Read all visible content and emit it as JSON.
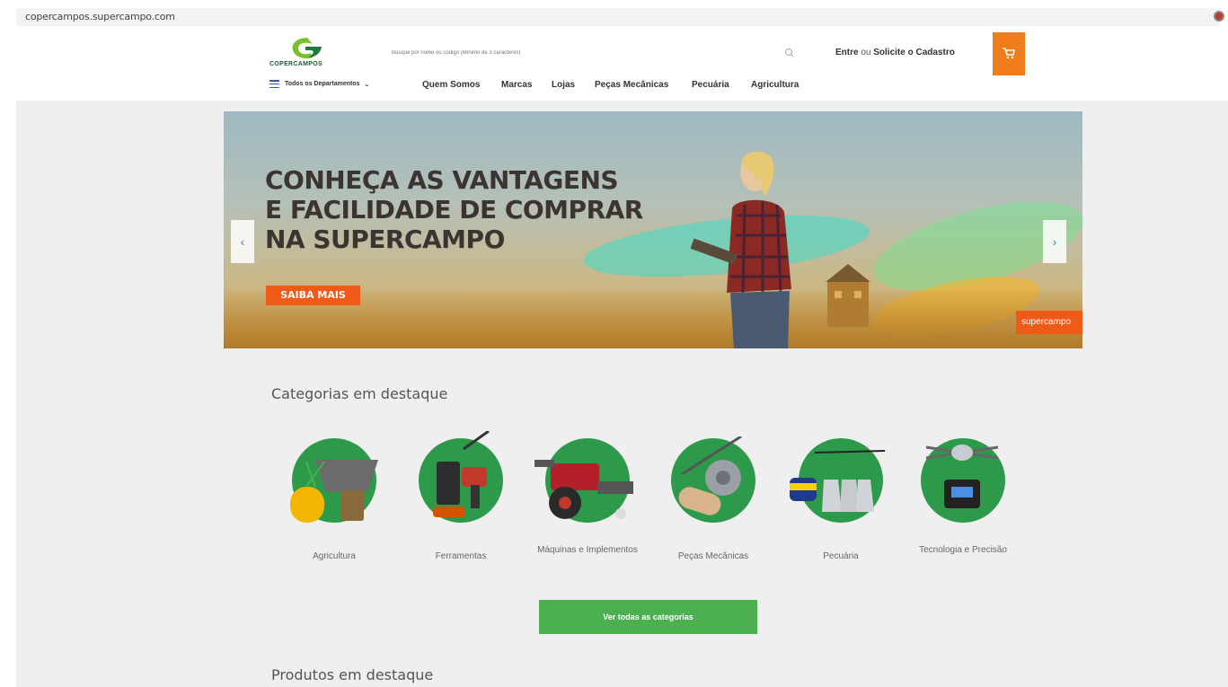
{
  "browser": {
    "url": "copercampos.supercampo.com"
  },
  "header": {
    "logo_text": "COPERCAMPOS",
    "search_placeholder": "Busque por nome ou código (Mínimo de 3 caracteres)",
    "account_enter": "Entre",
    "account_or": "ou",
    "account_register": "Solicite o Cadastro",
    "colors": {
      "accent": "#f07c1b",
      "brand_green": "#2d9a4b"
    }
  },
  "nav": {
    "all_departments": "Todos os Departamentos",
    "items": [
      "Quem Somos",
      "Marcas",
      "Lojas",
      "Peças Mecânicas",
      "Pecuária",
      "Agricultura"
    ]
  },
  "banner": {
    "title_lines": [
      "CONHEÇA AS VANTAGENS",
      "E FACILIDADE DE COMPRAR",
      "NA SUPERCAMPO"
    ],
    "button": "SAIBA MAIS",
    "brand_tag": "supercampo",
    "prev_icon": "chevron-left-icon",
    "next_icon": "chevron-right-icon"
  },
  "categories": {
    "title": "Categorias em destaque",
    "items": [
      {
        "label": "Agricultura",
        "icon": "agriculture-icon"
      },
      {
        "label": "Ferramentas",
        "icon": "tools-icon"
      },
      {
        "label": "Máquinas e Implementos",
        "icon": "machinery-icon"
      },
      {
        "label": "Peças Mecânicas",
        "icon": "mechanical-parts-icon"
      },
      {
        "label": "Pecuária",
        "icon": "livestock-icon"
      },
      {
        "label": "Tecnologia e Precisão",
        "icon": "drone-icon"
      }
    ],
    "view_all": "Ver todas as categorias"
  },
  "products": {
    "title": "Produtos em destaque"
  }
}
